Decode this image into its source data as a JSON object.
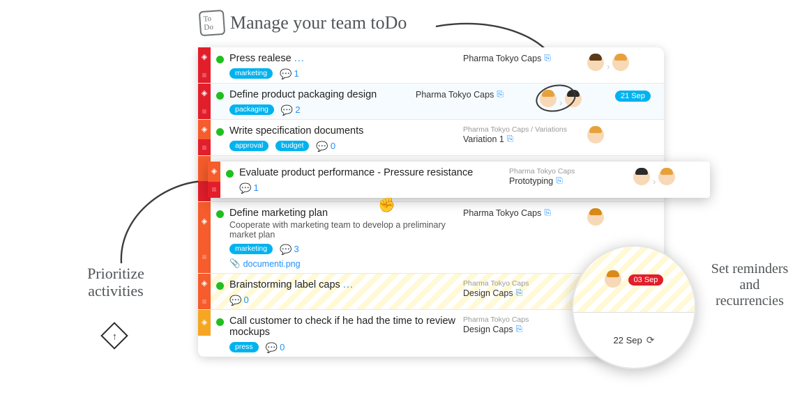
{
  "annotations": {
    "title": "Manage your team toDo",
    "left": "Prioritize activities",
    "right": "Set reminders and recurrencies",
    "logo_line1": "To",
    "logo_line2": "Do"
  },
  "tasks": [
    {
      "title": "Press realese",
      "more": "...",
      "tags": [
        "marketing"
      ],
      "comments": "1",
      "project_main": "Pharma Tokyo Caps",
      "people": [
        "a",
        "b"
      ],
      "gutter_top": "red",
      "gutter_bot": "red"
    },
    {
      "title": "Define product packaging design",
      "tags": [
        "packaging"
      ],
      "comments": "2",
      "project_main": "Pharma Tokyo Caps",
      "people": [
        "b",
        "c"
      ],
      "date": "21 Sep",
      "date_color": "blue",
      "gutter_top": "red",
      "gutter_bot": "red",
      "scribble": true
    },
    {
      "title": "Write specification documents",
      "tags": [
        "approval",
        "budget"
      ],
      "comments": "0",
      "project_path": "Pharma Tokyo Caps / Variations",
      "project_main": "Variation 1",
      "people": [
        "b"
      ],
      "gutter_top": "orange",
      "gutter_bot": "red"
    },
    {
      "title": "Evaluate product performance - Pressure resistance",
      "comments": "1",
      "project_path": "Pharma Tokyo Caps",
      "project_main": "Prototyping",
      "people": [
        "c",
        "b"
      ],
      "gutter_top": "orange",
      "gutter_bot": "red",
      "dragging": true
    },
    {
      "title": "Define marketing plan",
      "subtitle": "Cooperate with marketing team to develop a preliminary market plan",
      "tags": [
        "marketing"
      ],
      "comments": "3",
      "attachment": "documenti.png",
      "project_main": "Pharma Tokyo Caps",
      "people": [
        "d"
      ],
      "gutter_top": "orange",
      "gutter_bot": "orange"
    },
    {
      "title": "Brainstorming label caps",
      "more": "...",
      "comments": "0",
      "project_path": "Pharma Tokyo Caps",
      "project_main": "Design Caps",
      "people": [
        "c"
      ],
      "gutter_top": "orange",
      "gutter_bot": "orange",
      "striped": true
    },
    {
      "title": "Call customer to check if he had the time to review mockups",
      "tags": [
        "press"
      ],
      "comments": "0",
      "project_path": "Pharma Tokyo Caps",
      "project_main": "Design Caps",
      "people": [
        "b"
      ],
      "gutter_top": "amber"
    }
  ],
  "lens": {
    "date_badge": "03 Sep",
    "recurrence": "22 Sep"
  }
}
